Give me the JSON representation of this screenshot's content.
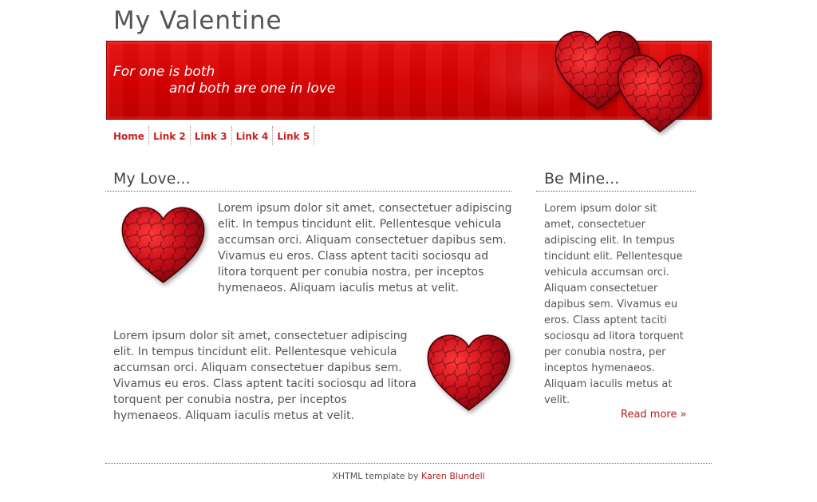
{
  "site": {
    "title": "My Valentine"
  },
  "banner": {
    "tagline_line1": "For one is both",
    "tagline_line2": "and both are one in love"
  },
  "nav": {
    "items": [
      {
        "label": "Home"
      },
      {
        "label": "Link 2"
      },
      {
        "label": "Link 3"
      },
      {
        "label": "Link 4"
      },
      {
        "label": "Link 5"
      }
    ]
  },
  "main": {
    "title": "My Love...",
    "paragraph1": "Lorem ipsum dolor sit amet, consectetuer adipiscing elit. In tempus tincidunt elit. Pellentesque vehicula accumsan orci. Aliquam consectetuer dapibus sem. Vivamus eu eros. Class aptent taciti sociosqu ad litora torquent per conubia nostra, per inceptos hymenaeos. Aliquam iaculis metus at velit.",
    "paragraph2": "Lorem ipsum dolor sit amet, consectetuer adipiscing elit. In tempus tincidunt elit. Pellentesque vehicula accumsan orci. Aliquam consectetuer dapibus sem. Vivamus eu eros. Class aptent taciti sociosqu ad litora torquent per conubia nostra, per inceptos hymenaeos. Aliquam iaculis metus at velit."
  },
  "sidebar": {
    "title": "Be Mine...",
    "text": "Lorem ipsum dolor sit amet, consectetuer adipiscing elit. In tempus tincidunt elit. Pellentesque vehicula accumsan orci. Aliquam consectetuer dapibus sem. Vivamus eu eros. Class aptent taciti sociosqu ad litora torquent per conubia nostra, per inceptos hymenaeos. Aliquam iaculis metus at velit.",
    "read_more": "Read more »"
  },
  "footer": {
    "prefix": "XHTML template by",
    "author_link": "Karen Blundell"
  },
  "colors": {
    "accent": "#cc2222",
    "banner": "#d60000",
    "heart_dark": "#6a0008",
    "heart_light": "#e0101c"
  }
}
